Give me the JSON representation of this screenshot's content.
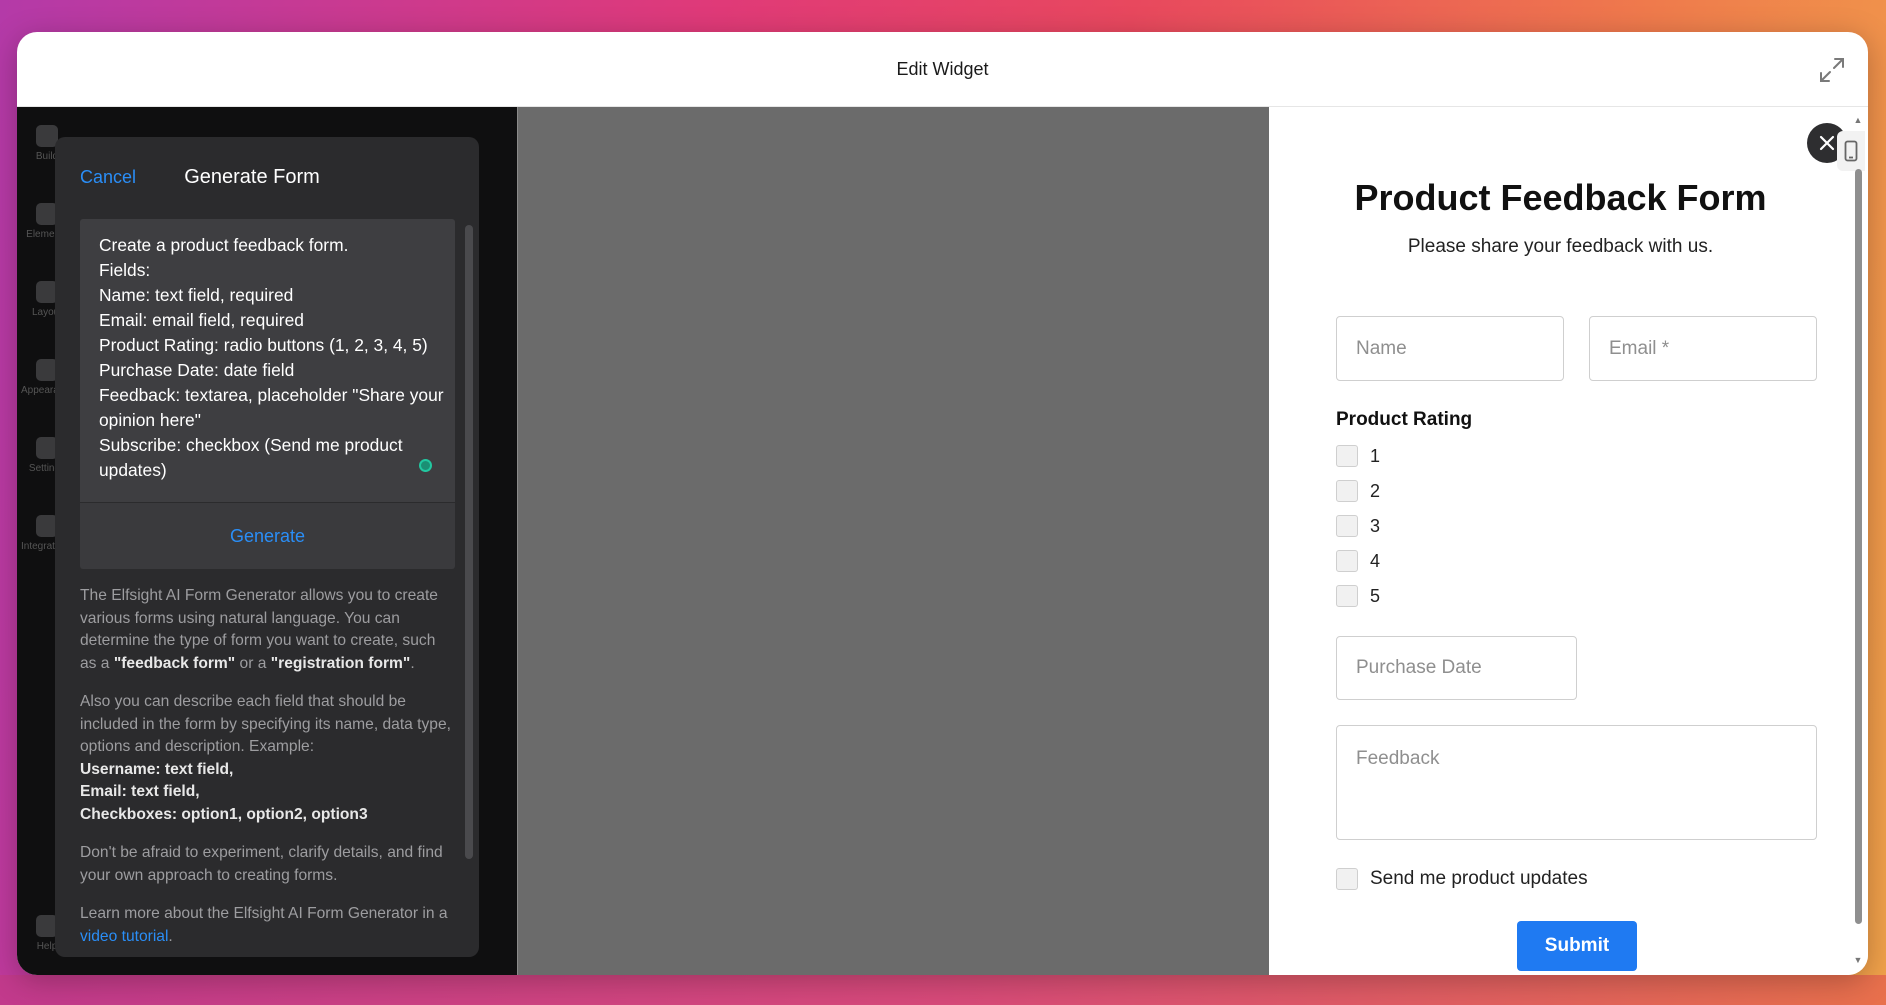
{
  "window": {
    "title": "Edit Widget"
  },
  "sidenav": {
    "items": [
      {
        "label": "Build"
      },
      {
        "label": "Elements"
      },
      {
        "label": "Layout"
      },
      {
        "label": "Appearance"
      },
      {
        "label": "Settings"
      },
      {
        "label": "Integrations"
      },
      {
        "label": "Help"
      }
    ]
  },
  "generator": {
    "cancel_label": "Cancel",
    "title": "Generate Form",
    "prompt": "Create a product feedback form.\nFields:\nName: text field, required\nEmail: email field, required\nProduct Rating: radio buttons (1, 2, 3, 4, 5)\nPurchase Date: date field\nFeedback: textarea, placeholder \"Share your opinion here\"\nSubscribe: checkbox (Send me product updates)",
    "generate_label": "Generate",
    "info": {
      "p1_a": "The Elfsight AI Form Generator allows you to create various forms using natural language. You can determine the type of form you want to create, such as a ",
      "p1_b": "\"feedback form\"",
      "p1_c": " or a ",
      "p1_d": "\"registration form\"",
      "p1_e": ".",
      "p2_a": "Also you can describe each field that should be included in the form by specifying its name, data type, options and description. Example:",
      "p2_ex1": "Username: text field,",
      "p2_ex2": "Email: text field,",
      "p2_ex3": "Checkboxes: option1, option2, option3",
      "p3": "Don't be afraid to experiment, clarify details, and find your own approach to creating forms.",
      "p4_a": "Learn more about the Elfsight AI Form Generator in a ",
      "p4_link": "video tutorial",
      "p4_b": "."
    }
  },
  "form": {
    "title": "Product Feedback Form",
    "subtitle": "Please share your feedback with us.",
    "name_placeholder": "Name",
    "email_placeholder": "Email *",
    "rating_label": "Product Rating",
    "rating_options": [
      "1",
      "2",
      "3",
      "4",
      "5"
    ],
    "purchase_date_placeholder": "Purchase Date",
    "feedback_placeholder": "Feedback",
    "subscribe_label": "Send me product updates",
    "submit_label": "Submit"
  },
  "colors": {
    "accent": "#1f7af2",
    "link": "#2a8ef7",
    "panel_bg": "#2b2b2d",
    "preview_bg": "#6b6b6b"
  }
}
